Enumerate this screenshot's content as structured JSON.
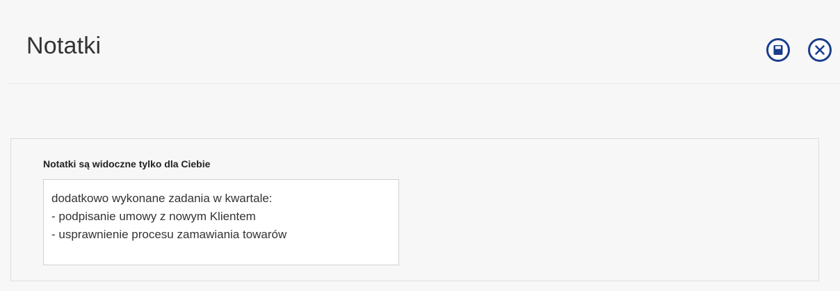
{
  "header": {
    "title": "Notatki",
    "actions": [
      {
        "name": "save",
        "icon": "floppy-disk-icon"
      },
      {
        "name": "close",
        "icon": "close-icon"
      }
    ],
    "accent_color": "#1a3e8c"
  },
  "notes_panel": {
    "label": "Notatki są widoczne tylko dla Ciebie",
    "value": "dodatkowo wykonane zadania w kwartale:\n- podpisanie umowy z nowym Klientem\n- usprawnienie procesu zamawiania towarów"
  }
}
